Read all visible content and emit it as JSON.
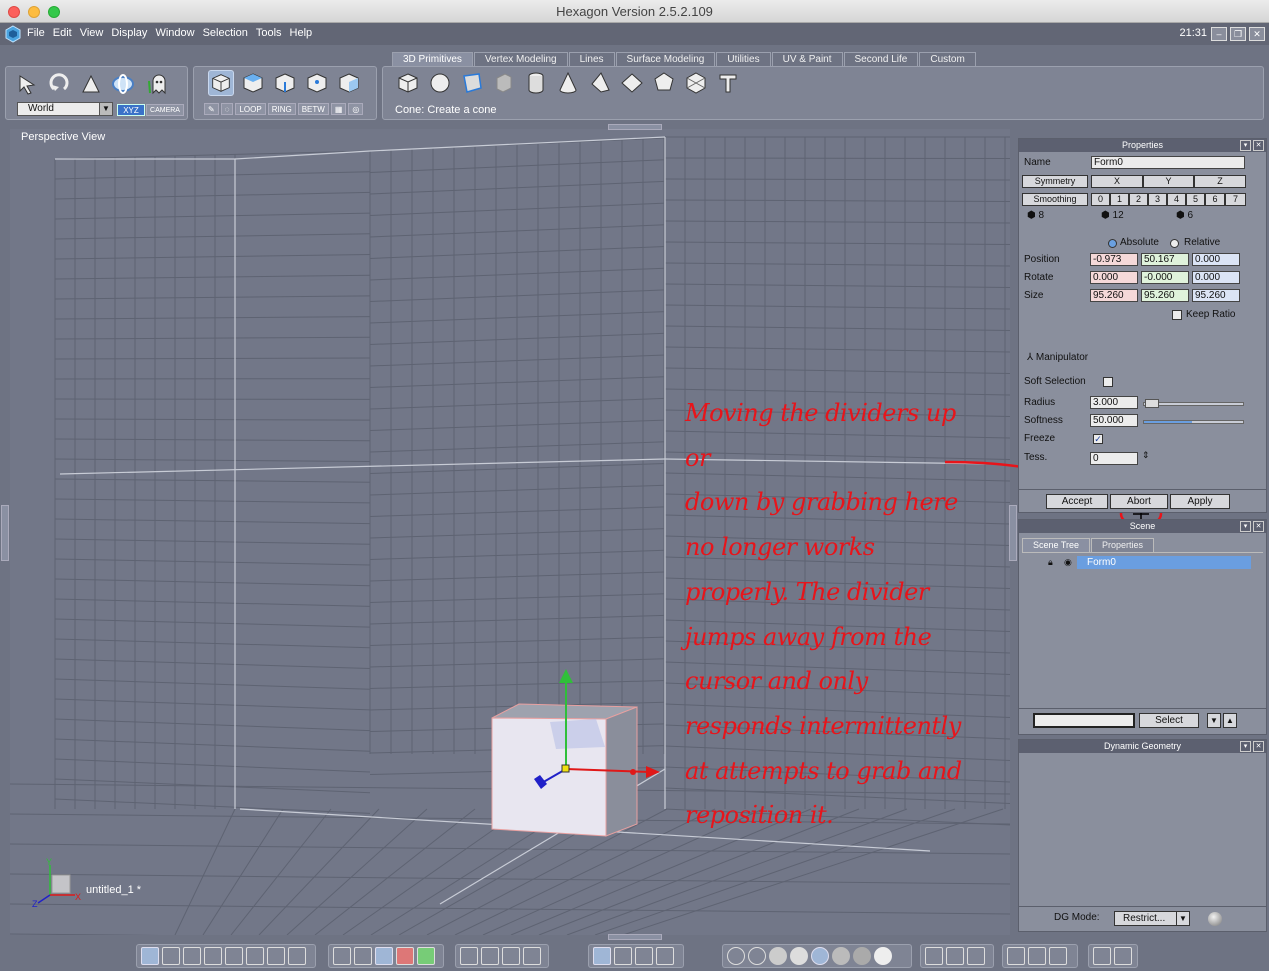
{
  "window": {
    "title": "Hexagon Version 2.5.2.109"
  },
  "menu": {
    "items": [
      "File",
      "Edit",
      "View",
      "Display",
      "Window",
      "Selection",
      "Tools",
      "Help"
    ],
    "clock": "21:31"
  },
  "toolbar": {
    "coord_space": "World",
    "xyz_label": "XYZ",
    "camera_label": "CAMERA",
    "edge_tools": [
      "LOOP",
      "RING",
      "BETW"
    ],
    "tabs": [
      "3D Primitives",
      "Vertex Modeling",
      "Lines",
      "Surface Modeling",
      "Utilities",
      "UV & Paint",
      "Second Life",
      "Custom"
    ],
    "active_tab": "3D Primitives",
    "status": "Cone: Create a cone"
  },
  "viewport": {
    "label": "Perspective  View",
    "file": "untitled_1 *",
    "axis_labels": {
      "x": "X",
      "y": "Y",
      "z": "Z"
    },
    "annotation_lines": [
      "Moving the dividers up or",
      "down by grabbing here",
      "no longer works",
      "properly. The divider",
      "jumps away from the",
      "cursor and only",
      "responds intermittently",
      "at attempts to grab and",
      "reposition it."
    ],
    "annotation_color": "#e8141a"
  },
  "properties": {
    "title": "Properties",
    "name_label": "Name",
    "name_value": "Form0",
    "symmetry_label": "Symmetry",
    "symmetry_axes": [
      "X",
      "Y",
      "Z"
    ],
    "smoothing_label": "Smoothing",
    "smoothing_levels": [
      "0",
      "1",
      "2",
      "3",
      "4",
      "5",
      "6",
      "7"
    ],
    "counts": [
      "8",
      "12",
      "6"
    ],
    "absolute_label": "Absolute",
    "relative_label": "Relative",
    "position_label": "Position",
    "position": [
      "-0.973",
      "50.167",
      "0.000"
    ],
    "rotate_label": "Rotate",
    "rotate": [
      "0.000",
      "-0.000",
      "0.000"
    ],
    "size_label": "Size",
    "size": [
      "95.260",
      "95.260",
      "95.260"
    ],
    "keep_ratio_label": "Keep Ratio",
    "manipulator_label": "Manipulator",
    "soft_selection_label": "Soft Selection",
    "radius_label": "Radius",
    "radius_value": "3.000",
    "softness_label": "Softness",
    "softness_value": "50.000",
    "freeze_label": "Freeze",
    "tess_label": "Tess.",
    "tess_value": "0",
    "accept_label": "Accept",
    "abort_label": "Abort",
    "apply_label": "Apply"
  },
  "scene": {
    "title": "Scene",
    "tabs": [
      "Scene Tree",
      "Properties"
    ],
    "items": [
      "Form0"
    ],
    "select_label": "Select"
  },
  "dynamic_geometry": {
    "title": "Dynamic Geometry",
    "mode_label": "DG Mode:",
    "mode_value": "Restrict..."
  }
}
